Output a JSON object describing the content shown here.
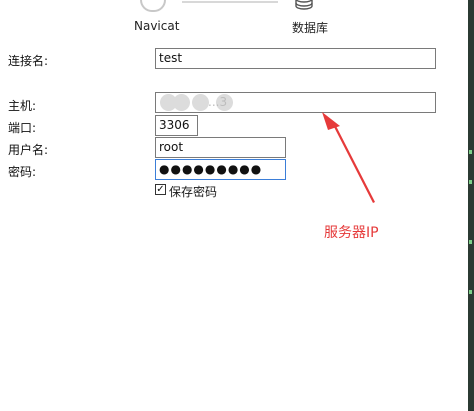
{
  "header": {
    "navicat_caption": "Navicat",
    "database_caption": "数据库",
    "navicat_icon": "navicat-logo-icon",
    "database_icon": "database-icon"
  },
  "form": {
    "connection_name": {
      "label": "连接名:",
      "value": "test"
    },
    "host": {
      "label": "主机:",
      "value": "...3"
    },
    "port": {
      "label": "端口:",
      "value": "3306"
    },
    "username": {
      "label": "用户名:",
      "value": "root"
    },
    "password": {
      "label": "密码:",
      "value": "●●●●●●●●●"
    },
    "save_password": {
      "label": "保存密码",
      "checked": true,
      "check_glyph": "✓"
    }
  },
  "annotation": {
    "text": "服务器IP",
    "color": "#e63a3a"
  },
  "colors": {
    "focus_border": "#3b7ed8",
    "field_border": "#7a7a7a"
  }
}
